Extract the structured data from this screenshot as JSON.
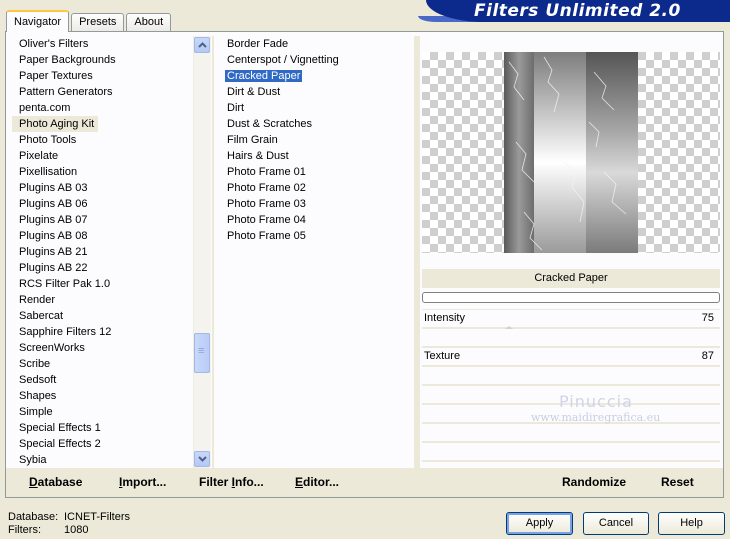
{
  "tabs": [
    {
      "label": "Navigator",
      "active": true
    },
    {
      "label": "Presets",
      "active": false
    },
    {
      "label": "About",
      "active": false
    }
  ],
  "app_title": "Filters Unlimited 2.0",
  "categories": [
    "Oliver's Filters",
    "Paper Backgrounds",
    "Paper Textures",
    "Pattern Generators",
    "penta.com",
    "Photo Aging Kit",
    "Photo Tools",
    "Pixelate",
    "Pixellisation",
    "Plugins AB 03",
    "Plugins AB 06",
    "Plugins AB 07",
    "Plugins AB 08",
    "Plugins AB 21",
    "Plugins AB 22",
    "RCS Filter Pak 1.0",
    "Render",
    "Sabercat",
    "Sapphire Filters 12",
    "ScreenWorks",
    "Scribe",
    "Sedsoft",
    "Shapes",
    "Simple",
    "Special Effects 1",
    "Special Effects 2",
    "Sybia"
  ],
  "selected_category": "Photo Aging Kit",
  "filters": [
    "Border Fade",
    "Centerspot / Vignetting",
    "Cracked Paper",
    "Dirt & Dust",
    "Dirt",
    "Dust & Scratches",
    "Film Grain",
    "Hairs & Dust",
    "Photo Frame 01",
    "Photo Frame 02",
    "Photo Frame 03",
    "Photo Frame 04",
    "Photo Frame 05"
  ],
  "selected_filter": "Cracked Paper",
  "current_filter_name": "Cracked Paper",
  "params": [
    {
      "label": "Intensity",
      "value": "75"
    },
    {
      "label": "Texture",
      "value": "87"
    }
  ],
  "watermark": {
    "line1": "Pinuccia",
    "line2": "www.maidiregrafica.eu"
  },
  "toolbar": {
    "database": {
      "u": "D",
      "rest": "atabase"
    },
    "import": {
      "u": "I",
      "rest": "mport..."
    },
    "filter_info": {
      "pre": "Filter ",
      "u": "I",
      "rest": "nfo..."
    },
    "editor": {
      "u": "E",
      "rest": "ditor..."
    },
    "randomize": "Randomize",
    "reset": "Reset"
  },
  "footer": {
    "database_label": "Database:",
    "database_value": "ICNET-Filters",
    "filters_label": "Filters:",
    "filters_value": "1080"
  },
  "buttons": {
    "apply": "Apply",
    "cancel": "Cancel",
    "help": "Help"
  },
  "colors": {
    "selection_blue": "#316ac5",
    "banner": "#0b2a8c",
    "face": "#ece9d8"
  }
}
